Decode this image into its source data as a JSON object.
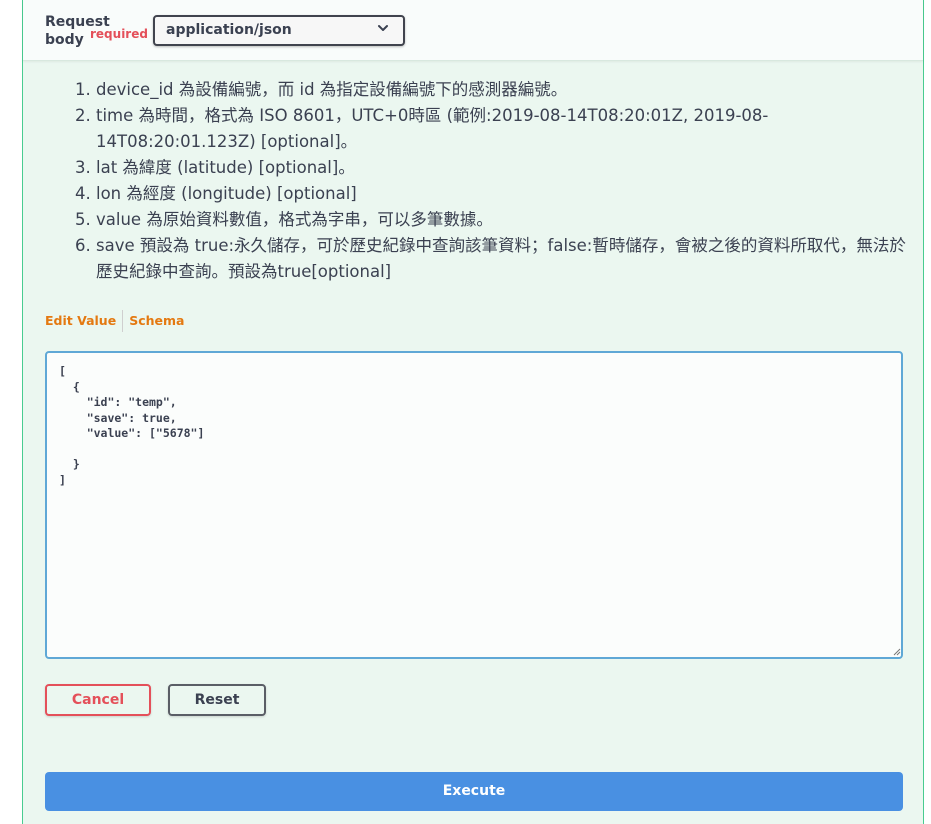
{
  "request_body": {
    "label_line1": "Request",
    "label_line2": "body",
    "required_label": "required",
    "content_type": "application/json"
  },
  "description_items": [
    "device_id 為設備編號，而 id 為指定設備編號下的感測器編號。",
    "time 為時間，格式為 ISO 8601，UTC+0時區 (範例:2019-08-14T08:20:01Z, 2019-08-14T08:20:01.123Z) [optional]。",
    "lat 為緯度 (latitude) [optional]。",
    "lon 為經度 (longitude) [optional]",
    "value 為原始資料數值，格式為字串，可以多筆數據。",
    "save 預設為 true:永久儲存，可於歷史紀錄中查詢該筆資料；false:暫時儲存，會被之後的資料所取代，無法於歷史紀錄中查詢。預設為true[optional]"
  ],
  "tabs": {
    "edit_value": "Edit Value",
    "schema": "Schema"
  },
  "editor": {
    "value": "[\n  {\n    \"id\": \"temp\",\n    \"save\": true,\n    \"value\": [\"5678\"]\n\n  }\n]"
  },
  "buttons": {
    "cancel": "Cancel",
    "reset": "Reset",
    "execute": "Execute"
  },
  "colors": {
    "accent_green": "#49cc90",
    "panel_bg": "#ebf7f0",
    "required_red": "#e4505a",
    "tab_orange": "#e47911",
    "execute_blue": "#4990e2",
    "editor_border": "#5fa8d6"
  },
  "icons": {
    "select_arrow": "chevron-down-icon",
    "resize": "resize-grip-icon"
  }
}
